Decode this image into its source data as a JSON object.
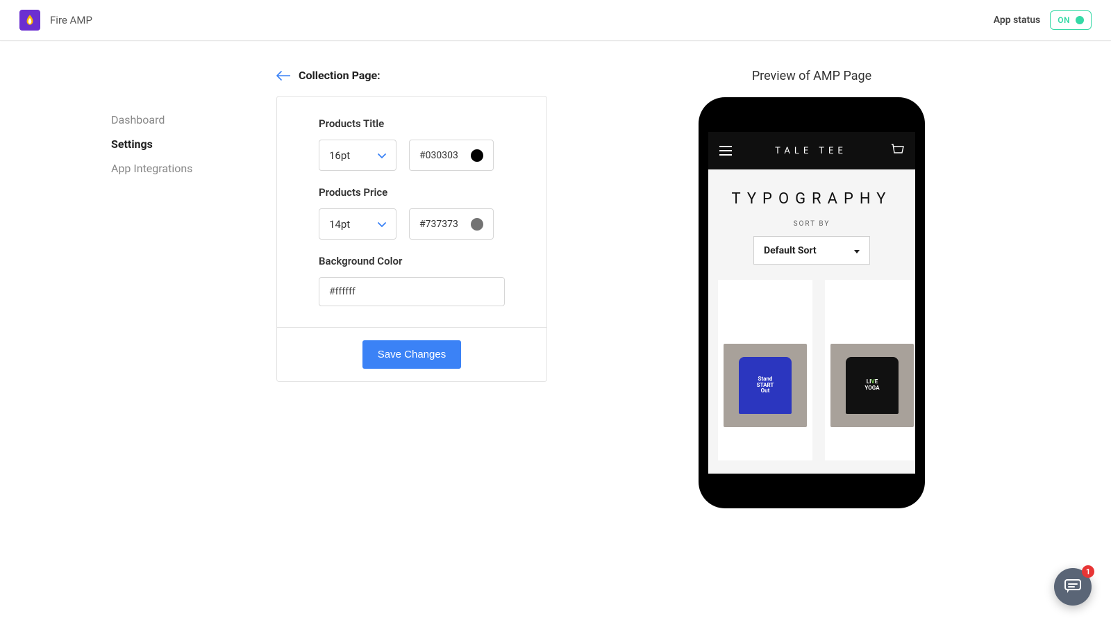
{
  "header": {
    "app_name": "Fire AMP",
    "status_label": "App status",
    "status_value": "ON"
  },
  "sidebar": {
    "items": [
      {
        "label": "Dashboard",
        "active": false
      },
      {
        "label": "Settings",
        "active": true
      },
      {
        "label": "App Integrations",
        "active": false
      }
    ]
  },
  "page": {
    "title": "Collection Page:"
  },
  "settings": {
    "products_title": {
      "label": "Products Title",
      "size": "16pt",
      "color": "#030303"
    },
    "products_price": {
      "label": "Products Price",
      "size": "14pt",
      "color": "#737373"
    },
    "background": {
      "label": "Background Color",
      "color": "#ffffff"
    },
    "save_button": "Save Changes"
  },
  "preview": {
    "title": "Preview of AMP Page",
    "store_name": "TALE TEE",
    "collection_title": "TYPOGRAPHY",
    "sort_label": "SORT BY",
    "sort_value": "Default Sort",
    "products": [
      {
        "variant": "blue",
        "text": "Stand\nSTART\nOut"
      },
      {
        "variant": "black",
        "text": "LIVE\nYOGA"
      }
    ]
  },
  "chat": {
    "badge": "1"
  },
  "colors": {
    "swatch_title": "#030303",
    "swatch_price": "#737373"
  }
}
